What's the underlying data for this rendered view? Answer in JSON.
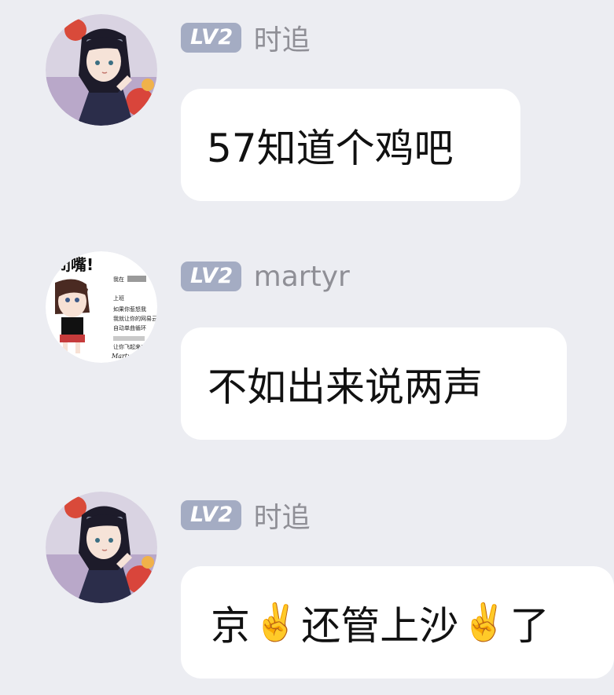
{
  "messages": [
    {
      "level": "LV2",
      "sender": "时追",
      "text_parts": [
        "57知道个鸡吧"
      ],
      "avatar_icon": "anime-girl-ninja-avatar"
    },
    {
      "level": "LV2",
      "sender": "martyr",
      "text_parts": [
        "不如出来说两声"
      ],
      "avatar_icon": "anime-girl-sticker-avatar",
      "avatar_texts": {
        "banner": "闭嘴!",
        "line1": "我在",
        "line2": "上班",
        "line3": "如果你惹怒我",
        "line4": "我就让你的网易云",
        "line5": "自动单曲循环",
        "line6": "让你飞起来!",
        "signature": "Martyr"
      }
    },
    {
      "level": "LV2",
      "sender": "时追",
      "text_parts": [
        "京",
        "✌️",
        "还管上沙",
        "✌️",
        "了"
      ],
      "avatar_icon": "anime-girl-ninja-avatar"
    }
  ],
  "colors": {
    "background": "#ecedf2",
    "bubble": "#ffffff",
    "badge": "#a4acc3",
    "sender": "#8f8f96",
    "text": "#111111"
  }
}
